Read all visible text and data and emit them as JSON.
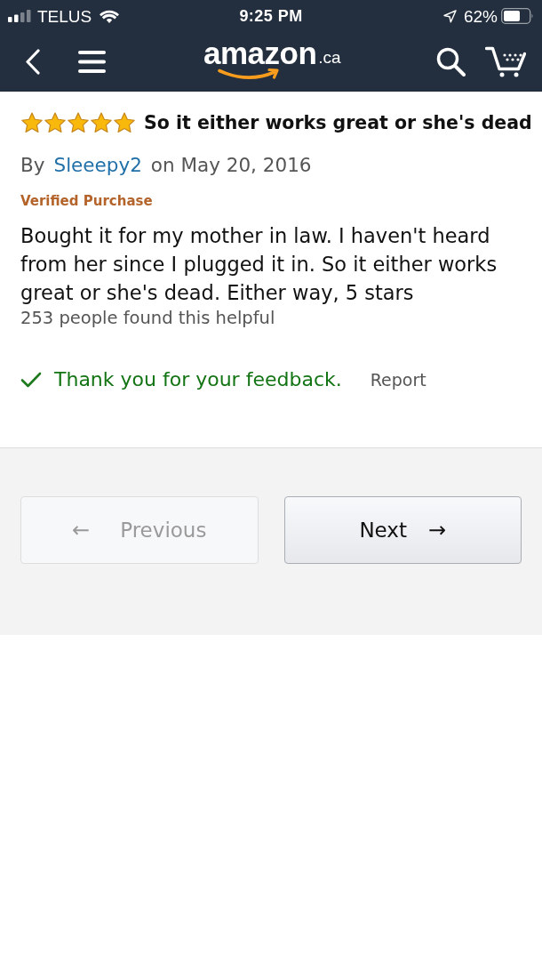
{
  "status_bar": {
    "carrier": "TELUS",
    "time": "9:25 PM",
    "battery": "62%"
  },
  "header": {
    "logo": {
      "name": "amazon",
      "domain": ".ca"
    }
  },
  "review": {
    "stars": 5,
    "title": "So it either works great or she's dead",
    "by": "By",
    "author": "Sleeepy2",
    "date": "on May 20, 2016",
    "badge": "Verified Purchase",
    "body": "Bought it for my mother in law. I haven't heard from her since I plugged it in. So it either works great or she's dead. Either way, 5 stars",
    "helpful": "253 people found this helpful",
    "feedback": "Thank you for your feedback.",
    "report": "Report"
  },
  "pagination": [
    {
      "kind": "previous",
      "label": "Previous",
      "arrow": "←",
      "disabled": true
    },
    {
      "kind": "next",
      "label": "Next",
      "arrow": "→",
      "disabled": false
    }
  ]
}
